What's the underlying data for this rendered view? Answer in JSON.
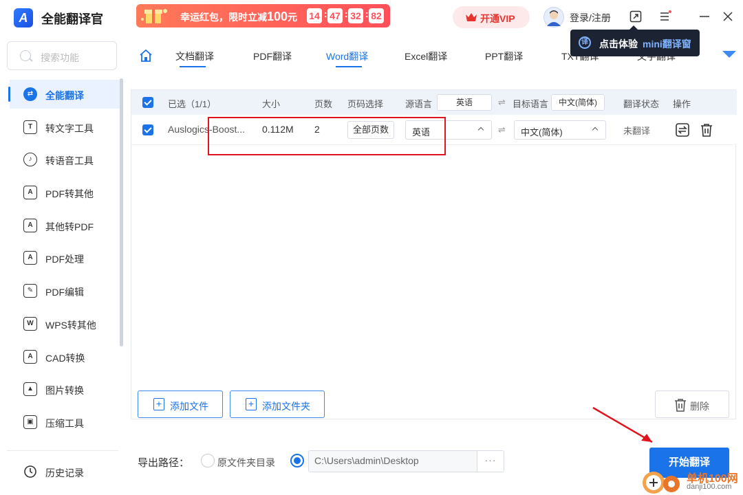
{
  "app": {
    "title": "全能翻译官",
    "logo_letter": "A"
  },
  "promo": {
    "text_prefix": "幸运红包，限时立减",
    "amount": "100",
    "unit": "元",
    "timer": [
      "14",
      "47",
      "32",
      "82"
    ]
  },
  "header": {
    "vip_label": "开通VIP",
    "login_label": "登录/注册",
    "mini_tip_prefix": "点击体验",
    "mini_tip_highlight": "mini翻译窗"
  },
  "sidebar": {
    "search_placeholder": "搜索功能",
    "items": [
      {
        "label": "全能翻译",
        "icon": "translate-icon",
        "glyph": "⇄",
        "active": true
      },
      {
        "label": "转文字工具",
        "icon": "text-tool-icon",
        "glyph": "T"
      },
      {
        "label": "转语音工具",
        "icon": "voice-icon",
        "glyph": "♪"
      },
      {
        "label": "PDF转其他",
        "icon": "pdf-convert-icon",
        "glyph": "A"
      },
      {
        "label": "其他转PDF",
        "icon": "to-pdf-icon",
        "glyph": "A"
      },
      {
        "label": "PDF处理",
        "icon": "pdf-process-icon",
        "glyph": "A"
      },
      {
        "label": "PDF编辑",
        "icon": "pdf-edit-icon",
        "glyph": "✎"
      },
      {
        "label": "WPS转其他",
        "icon": "wps-icon",
        "glyph": "W"
      },
      {
        "label": "CAD转换",
        "icon": "cad-icon",
        "glyph": "A"
      },
      {
        "label": "图片转换",
        "icon": "image-icon",
        "glyph": "▲"
      },
      {
        "label": "压缩工具",
        "icon": "compress-icon",
        "glyph": "▣"
      }
    ],
    "history_label": "历史记录"
  },
  "tabs": [
    {
      "label": "文档翻译",
      "active": false
    },
    {
      "label": "PDF翻译",
      "active": false
    },
    {
      "label": "Word翻译",
      "active": true
    },
    {
      "label": "Excel翻译",
      "active": false
    },
    {
      "label": "PPT翻译",
      "active": false
    },
    {
      "label": "TXT翻译",
      "active": false
    },
    {
      "label": "文字翻译",
      "active": false
    }
  ],
  "table": {
    "headers": {
      "selected": "已选（1/1）",
      "size": "大小",
      "pages": "页数",
      "page_select": "页码选择",
      "source_lang": "源语言",
      "source_lang_value": "英语",
      "target_lang": "目标语言",
      "target_lang_value": "中文(简体)",
      "status": "翻译状态",
      "action": "操作"
    },
    "rows": [
      {
        "filename": "Auslogics-Boost...",
        "size": "0.112M",
        "pages": "2",
        "page_select": "全部页数",
        "source": "英语",
        "target": "中文(简体)",
        "status": "未翻译"
      }
    ]
  },
  "buttons": {
    "add_file": "添加文件",
    "add_folder": "添加文件夹",
    "delete": "删除",
    "start": "开始翻译"
  },
  "export": {
    "label": "导出路径：",
    "option_original": "原文件夹目录",
    "path": "C:\\Users\\admin\\Desktop",
    "more": "···"
  },
  "watermark": {
    "line1": "单机100网",
    "line2": "danji100.com"
  },
  "colors": {
    "accent": "#1a73e8",
    "promo": "#ff4f59",
    "highlight_box": "#e0141e"
  }
}
